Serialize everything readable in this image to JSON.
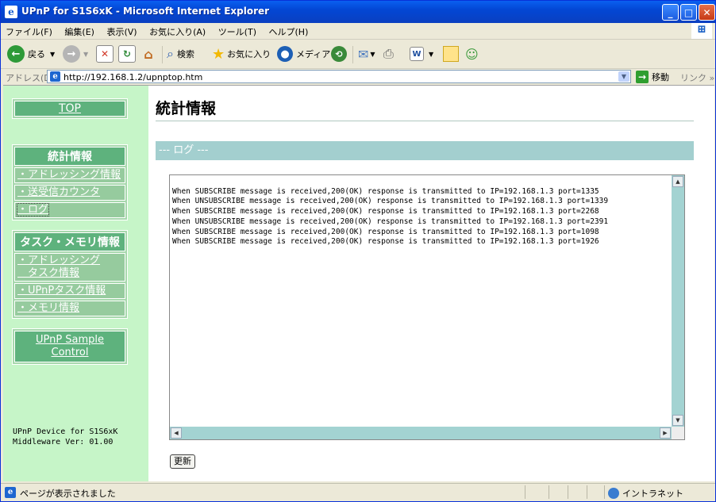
{
  "window": {
    "title": "UPnP for S1S6xK - Microsoft Internet Explorer",
    "app_icon": "ie-page-icon",
    "controls": {
      "minimize": "_",
      "maximize": "□",
      "close": "✕"
    }
  },
  "menubar": {
    "items": [
      "ファイル(F)",
      "編集(E)",
      "表示(V)",
      "お気に入り(A)",
      "ツール(T)",
      "ヘルプ(H)"
    ]
  },
  "toolbar": {
    "back_label": "戻る",
    "search_label": "検索",
    "favorites_label": "お気に入り",
    "media_label": "メディア",
    "icons": [
      "back-arrow-icon",
      "forward-arrow-icon",
      "stop-icon",
      "refresh-icon",
      "home-icon",
      "search-icon",
      "favorites-star-icon",
      "media-globe-icon",
      "history-icon",
      "mail-icon",
      "print-icon",
      "edit-icon",
      "discuss-icon",
      "messenger-icon"
    ]
  },
  "addressbar": {
    "label": "アドレス(D)",
    "url": "http://192.168.1.2/upnptop.htm",
    "go_label": "移動",
    "links_label": "リンク »"
  },
  "sidebar": {
    "top_link": "TOP",
    "stats_header": "統計情報",
    "stats_items": [
      "・アドレッシング情報",
      "・送受信カウンタ",
      "・ログ"
    ],
    "task_header": "タスク・メモリ情報",
    "task_items": [
      "・アドレッシング\n　タスク情報",
      "・UPnPタスク情報",
      "・メモリ情報"
    ],
    "sample_link_line1": "UPnP Sample",
    "sample_link_line2": "Control",
    "device_line1": "UPnP Device for S1S6xK",
    "device_line2": "Middleware Ver: 01.00"
  },
  "main": {
    "title": "統計情報",
    "section_header": "--- ログ ---",
    "log_lines": [
      "When SUBSCRIBE message is received,200(OK) response is transmitted to IP=192.168.1.3 port=1335",
      "When UNSUBSCRIBE message is received,200(OK) response is transmitted to IP=192.168.1.3 port=1339",
      "When SUBSCRIBE message is received,200(OK) response is transmitted to IP=192.168.1.3 port=2268",
      "When UNSUBSCRIBE message is received,200(OK) response is transmitted to IP=192.168.1.3 port=2391",
      "When SUBSCRIBE message is received,200(OK) response is transmitted to IP=192.168.1.3 port=1098",
      "When SUBSCRIBE message is received,200(OK) response is transmitted to IP=192.168.1.3 port=1926"
    ],
    "refresh_button": "更新"
  },
  "statusbar": {
    "text": "ページが表示されました",
    "zone": "イントラネット"
  },
  "colors": {
    "sidebar_bg": "#C6F5C8",
    "menu_header": "#5EB27D",
    "section_header": "#A3CFCF",
    "titlebar": "#0347D4"
  }
}
